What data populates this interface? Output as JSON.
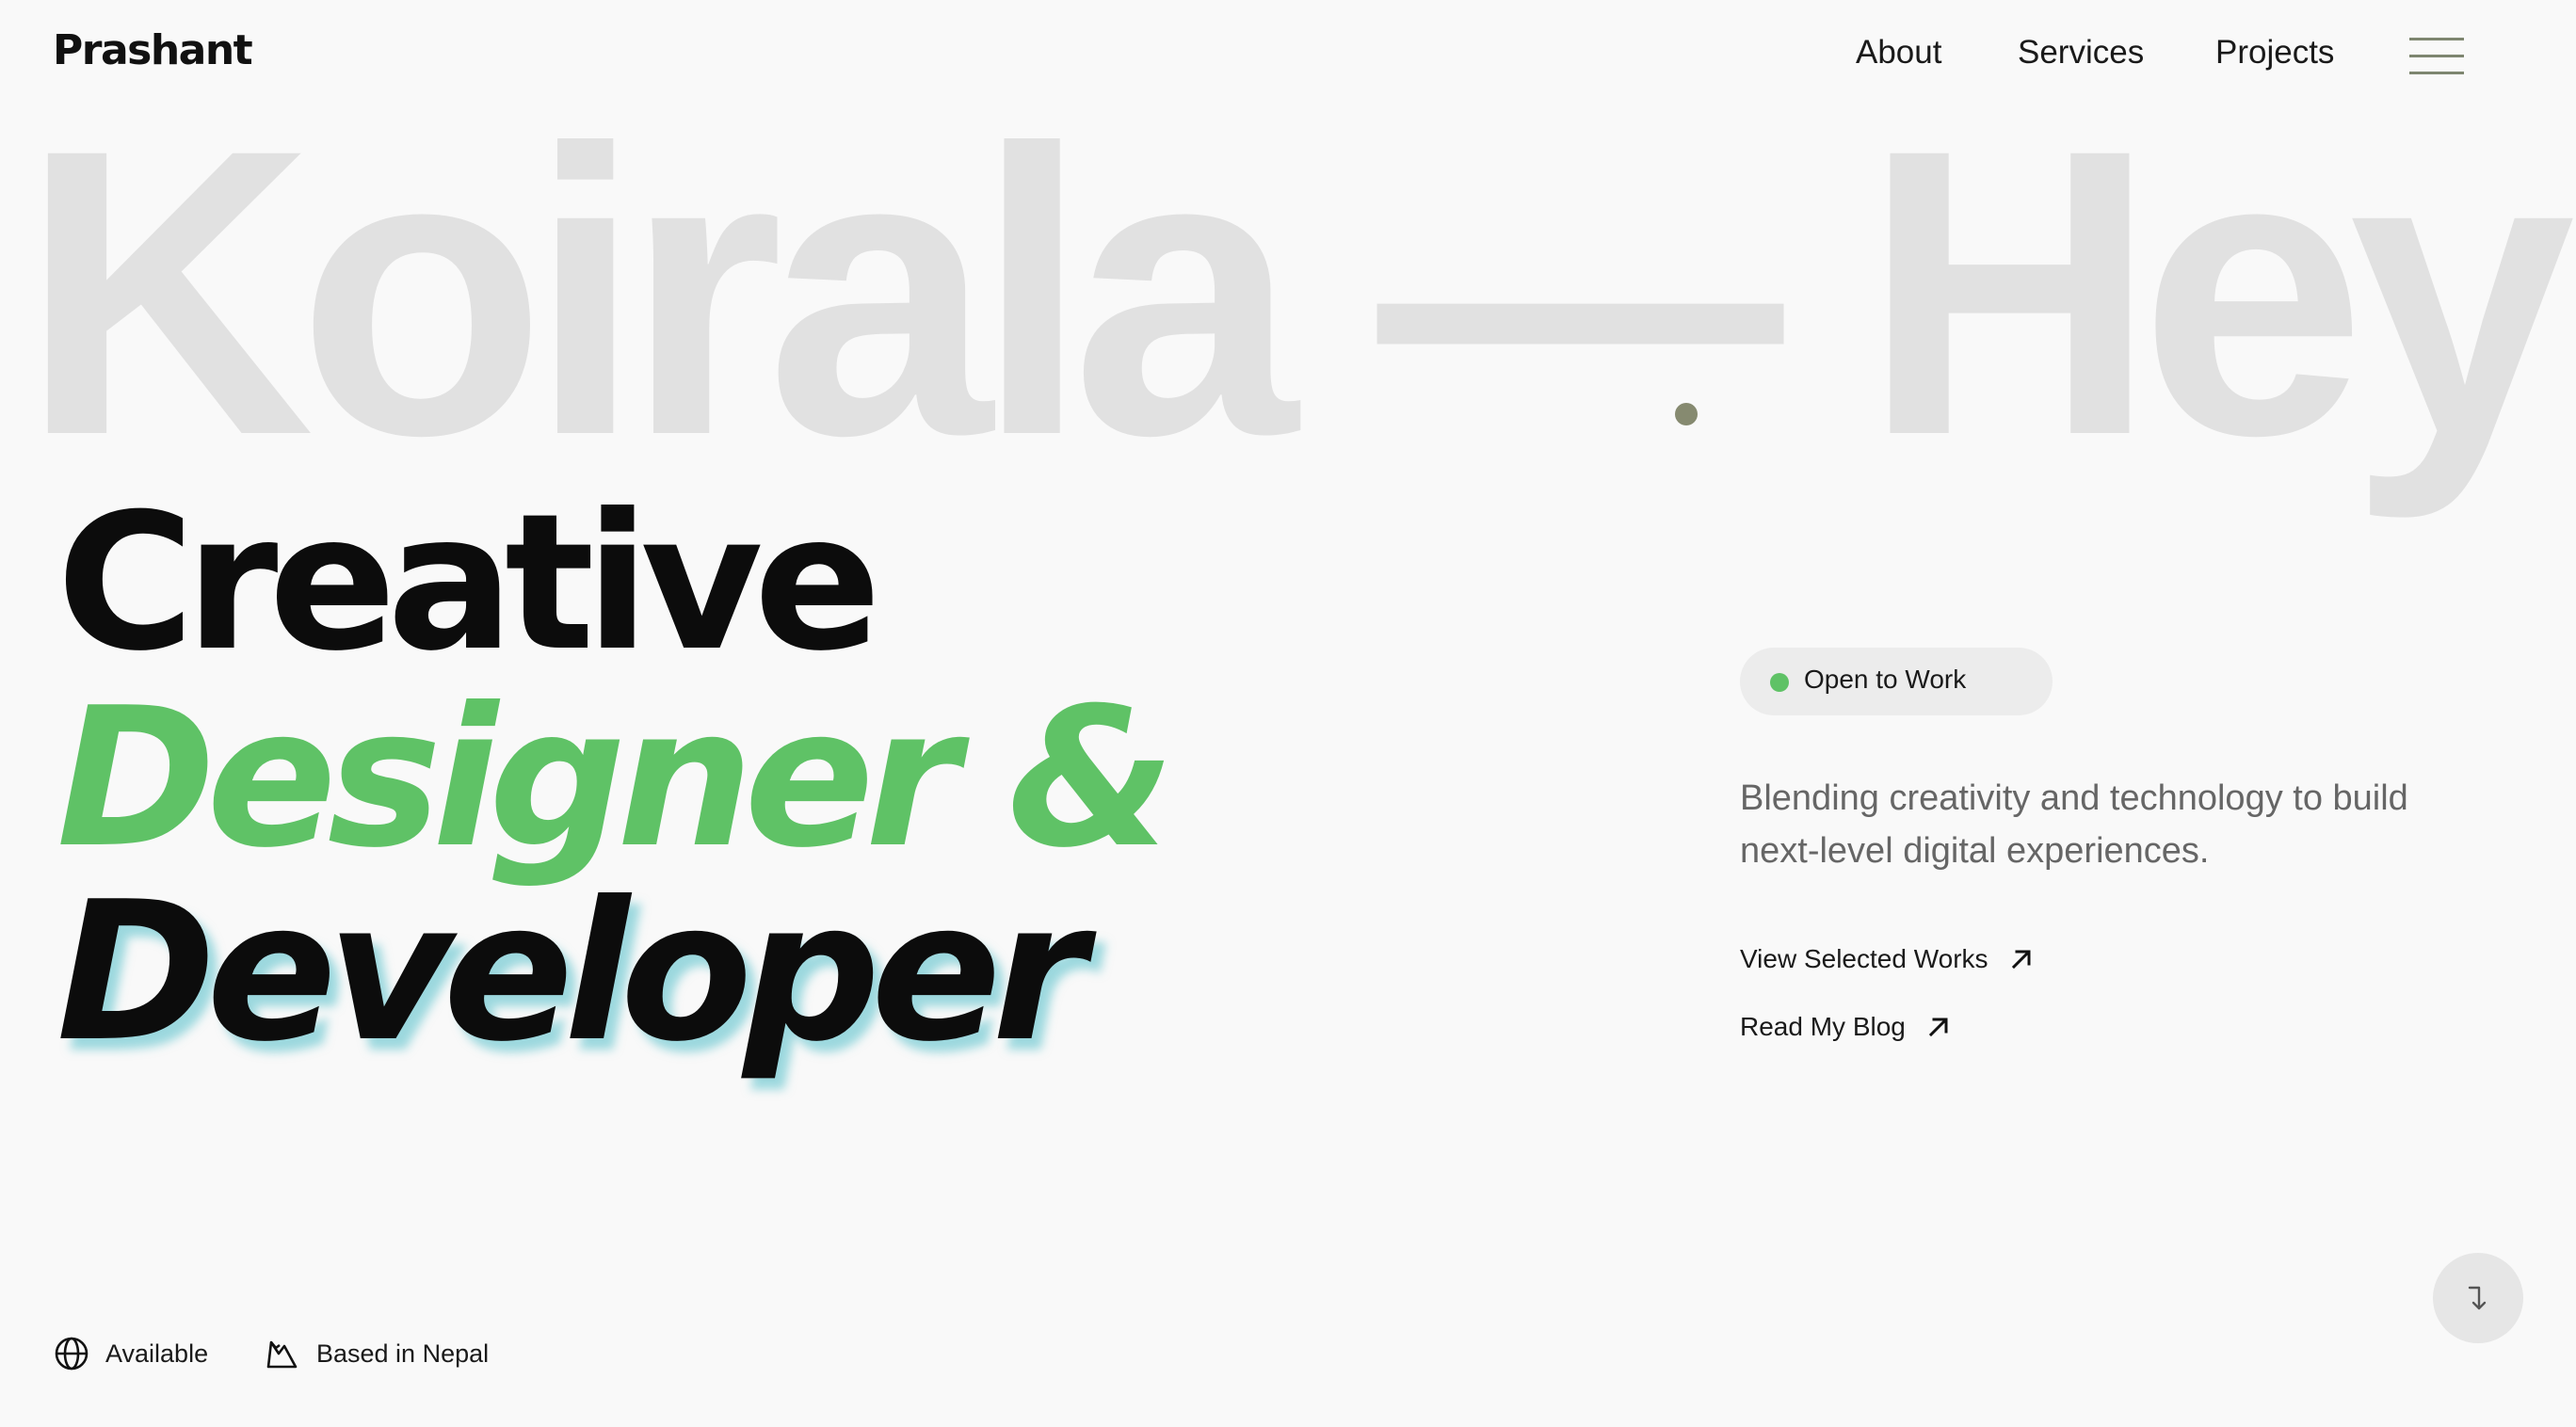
{
  "header": {
    "logo": "Prashant",
    "nav": {
      "about": "About",
      "services": "Services",
      "projects": "Projects"
    },
    "menu_icon": "hamburger-icon"
  },
  "marquee": {
    "text": "Koirala — Hey"
  },
  "hero": {
    "line1": "Creative",
    "line2": "Designer &",
    "line3": "Developer"
  },
  "status": {
    "label": "Open to Work",
    "color": "#5fc266"
  },
  "tagline": "Blending creativity and technology to build next-level digital experiences.",
  "links": {
    "works": "View Selected Works",
    "blog": "Read My Blog",
    "icon": "arrow-up-right-icon"
  },
  "footer": {
    "available": "Available",
    "location": "Based in Nepal",
    "available_icon": "globe-icon",
    "location_icon": "mountain-icon"
  },
  "scroll_icon": "arrow-down-turn-icon",
  "colors": {
    "background": "#f9f9f9",
    "accent": "#5fc266",
    "marquee": "#e1e1e1",
    "menu": "#7e8670"
  }
}
